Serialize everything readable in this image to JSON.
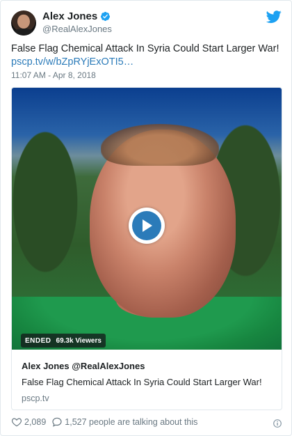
{
  "author": {
    "name": "Alex Jones",
    "handle": "@RealAlexJones",
    "verified": true
  },
  "tweet": {
    "text": "False Flag Chemical Attack In Syria Could Start Larger War!",
    "link": "pscp.tv/w/bZpRYjExOTI5…",
    "timestamp": "11:07 AM - Apr 8, 2018"
  },
  "media": {
    "status_label": "ENDED",
    "viewers": "69.3k Viewers",
    "play_icon": "play-icon"
  },
  "card": {
    "title": "Alex Jones @RealAlexJones",
    "description": "False Flag Chemical Attack In Syria Could Start Larger War!",
    "domain": "pscp.tv"
  },
  "actions": {
    "likes": "2,089",
    "talking": "1,527 people are talking about this"
  },
  "colors": {
    "twitter_blue": "#1da1f2",
    "link_blue": "#2b7bb9",
    "muted_text": "#697882"
  }
}
